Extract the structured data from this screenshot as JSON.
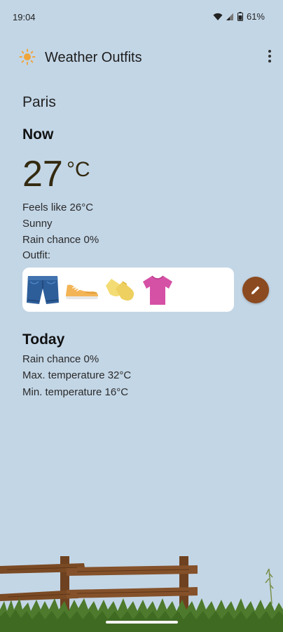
{
  "status_bar": {
    "time": "19:04",
    "battery": "61%"
  },
  "app_bar": {
    "title": "Weather Outfits",
    "icon": "sun-icon",
    "menu_icon": "more-vert-icon"
  },
  "location": {
    "city": "Paris"
  },
  "now": {
    "heading": "Now",
    "temperature": "27",
    "unit": "°C",
    "feels_like": "Feels like 26°C",
    "condition": "Sunny",
    "rain_chance": "Rain chance 0%",
    "outfit_label": "Outfit:",
    "outfit_items": [
      "shorts-icon",
      "sneakers-icon",
      "socks-icon",
      "t-shirt-icon"
    ]
  },
  "today": {
    "heading": "Today",
    "rain_chance": "Rain chance 0%",
    "max_temp": "Max. temperature 32°C",
    "min_temp": "Min. temperature 16°C"
  },
  "colors": {
    "background": "#c3d6e6",
    "edit_button": "#8b4a1f",
    "sun": "#f0a53a",
    "grass": "#4d7a2c",
    "fence": "#7a4a24"
  }
}
